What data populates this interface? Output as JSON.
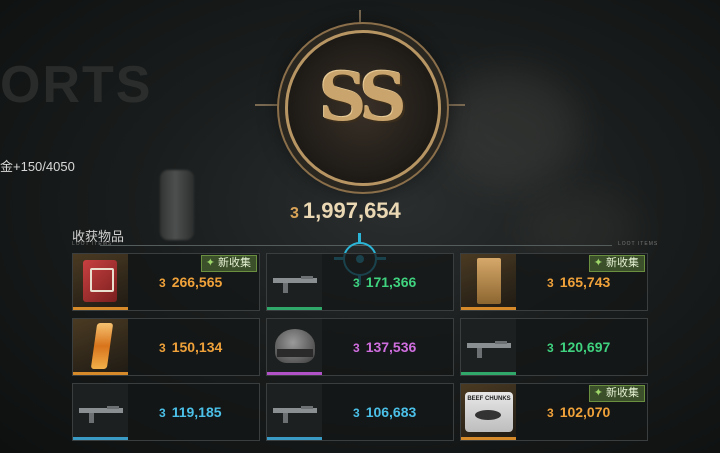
{
  "background": {
    "partial_title": "ORTS",
    "progress": "金+150/4050"
  },
  "rank": {
    "label": "SS"
  },
  "total_value": "1,997,654",
  "section": {
    "title": "收获物品",
    "sub_left": "LOOT ITEMS",
    "sub_right": "LOOT ITEMS"
  },
  "currency_icon": "3",
  "items": [
    {
      "value": "266,565",
      "color": "#f0a23a",
      "rarity": "#d78a2a",
      "new": true,
      "icon": "fuel-can-icon"
    },
    {
      "value": "171,366",
      "color": "#3fd27f",
      "rarity": "#2fa86a",
      "new": false,
      "icon": "rifle-icon"
    },
    {
      "value": "165,743",
      "color": "#f0a23a",
      "rarity": "#d78a2a",
      "new": true,
      "icon": "document-folder-icon"
    },
    {
      "value": "150,134",
      "color": "#f0a23a",
      "rarity": "#d78a2a",
      "new": false,
      "icon": "crystal-icon"
    },
    {
      "value": "137,536",
      "color": "#d06ee0",
      "rarity": "#b252c8",
      "new": false,
      "icon": "helmet-icon"
    },
    {
      "value": "120,697",
      "color": "#3fd27f",
      "rarity": "#2fa86a",
      "new": false,
      "icon": "rifle-icon"
    },
    {
      "value": "119,185",
      "color": "#4bc0e8",
      "rarity": "#3a9cc4",
      "new": false,
      "icon": "rifle-icon"
    },
    {
      "value": "106,683",
      "color": "#4bc0e8",
      "rarity": "#3a9cc4",
      "new": false,
      "icon": "rifle-icon"
    },
    {
      "value": "102,070",
      "color": "#f0a23a",
      "rarity": "#d78a2a",
      "new": true,
      "icon": "canned-beef-icon"
    }
  ],
  "new_badge_label": "新收集",
  "can_label": "BEEF CHUNKS"
}
